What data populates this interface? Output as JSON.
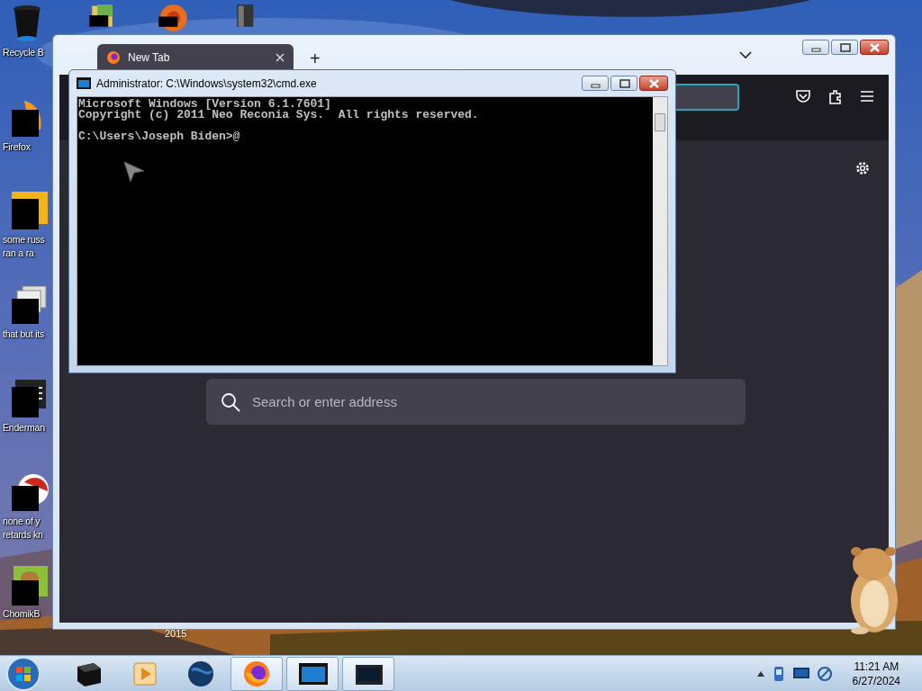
{
  "desktop_icons": [
    {
      "kind": "bin",
      "lines": [
        "Recycle B"
      ]
    },
    {
      "kind": "flame",
      "lines": [
        "Firefox"
      ]
    },
    {
      "kind": "yellow",
      "lines": [
        "some russ",
        "ran a ra"
      ]
    },
    {
      "kind": "stack",
      "lines": [
        "that but its"
      ]
    },
    {
      "kind": "dark",
      "lines": [
        "Enderman"
      ]
    },
    {
      "kind": "red",
      "lines": [
        "none of y",
        "retards kn"
      ]
    },
    {
      "kind": "green",
      "lines": [
        "ChomikB"
      ]
    }
  ],
  "top_icons": [
    {
      "kind": "folder"
    },
    {
      "kind": "orange"
    },
    {
      "kind": "device"
    }
  ],
  "desktop_label": "2015",
  "browser": {
    "tabs": [
      {
        "title": "New Tab",
        "selected": true
      }
    ],
    "new_tab": "+",
    "search": {
      "placeholder": "Search or enter address"
    }
  },
  "console_window": {
    "title": "Administrator: C:\\Windows\\system32\\cmd.exe",
    "output": [
      "Microsoft Windows [Version 6.1.7601]",
      "Copyright (c) 2011 Neo Reconia Sys.  All rights reserved."
    ],
    "prompt": "C:\\Users\\Joseph Biden>@"
  },
  "taskbar": {
    "buttons": [
      {
        "kind": "box",
        "open": false
      },
      {
        "kind": "player",
        "open": false
      },
      {
        "kind": "globe",
        "open": false
      },
      {
        "kind": "firefox",
        "open": true
      },
      {
        "kind": "console",
        "open": true
      },
      {
        "kind": "screen",
        "open": true
      }
    ],
    "clock": {
      "time": "11:21 AM",
      "date": "6/27/2024"
    }
  }
}
